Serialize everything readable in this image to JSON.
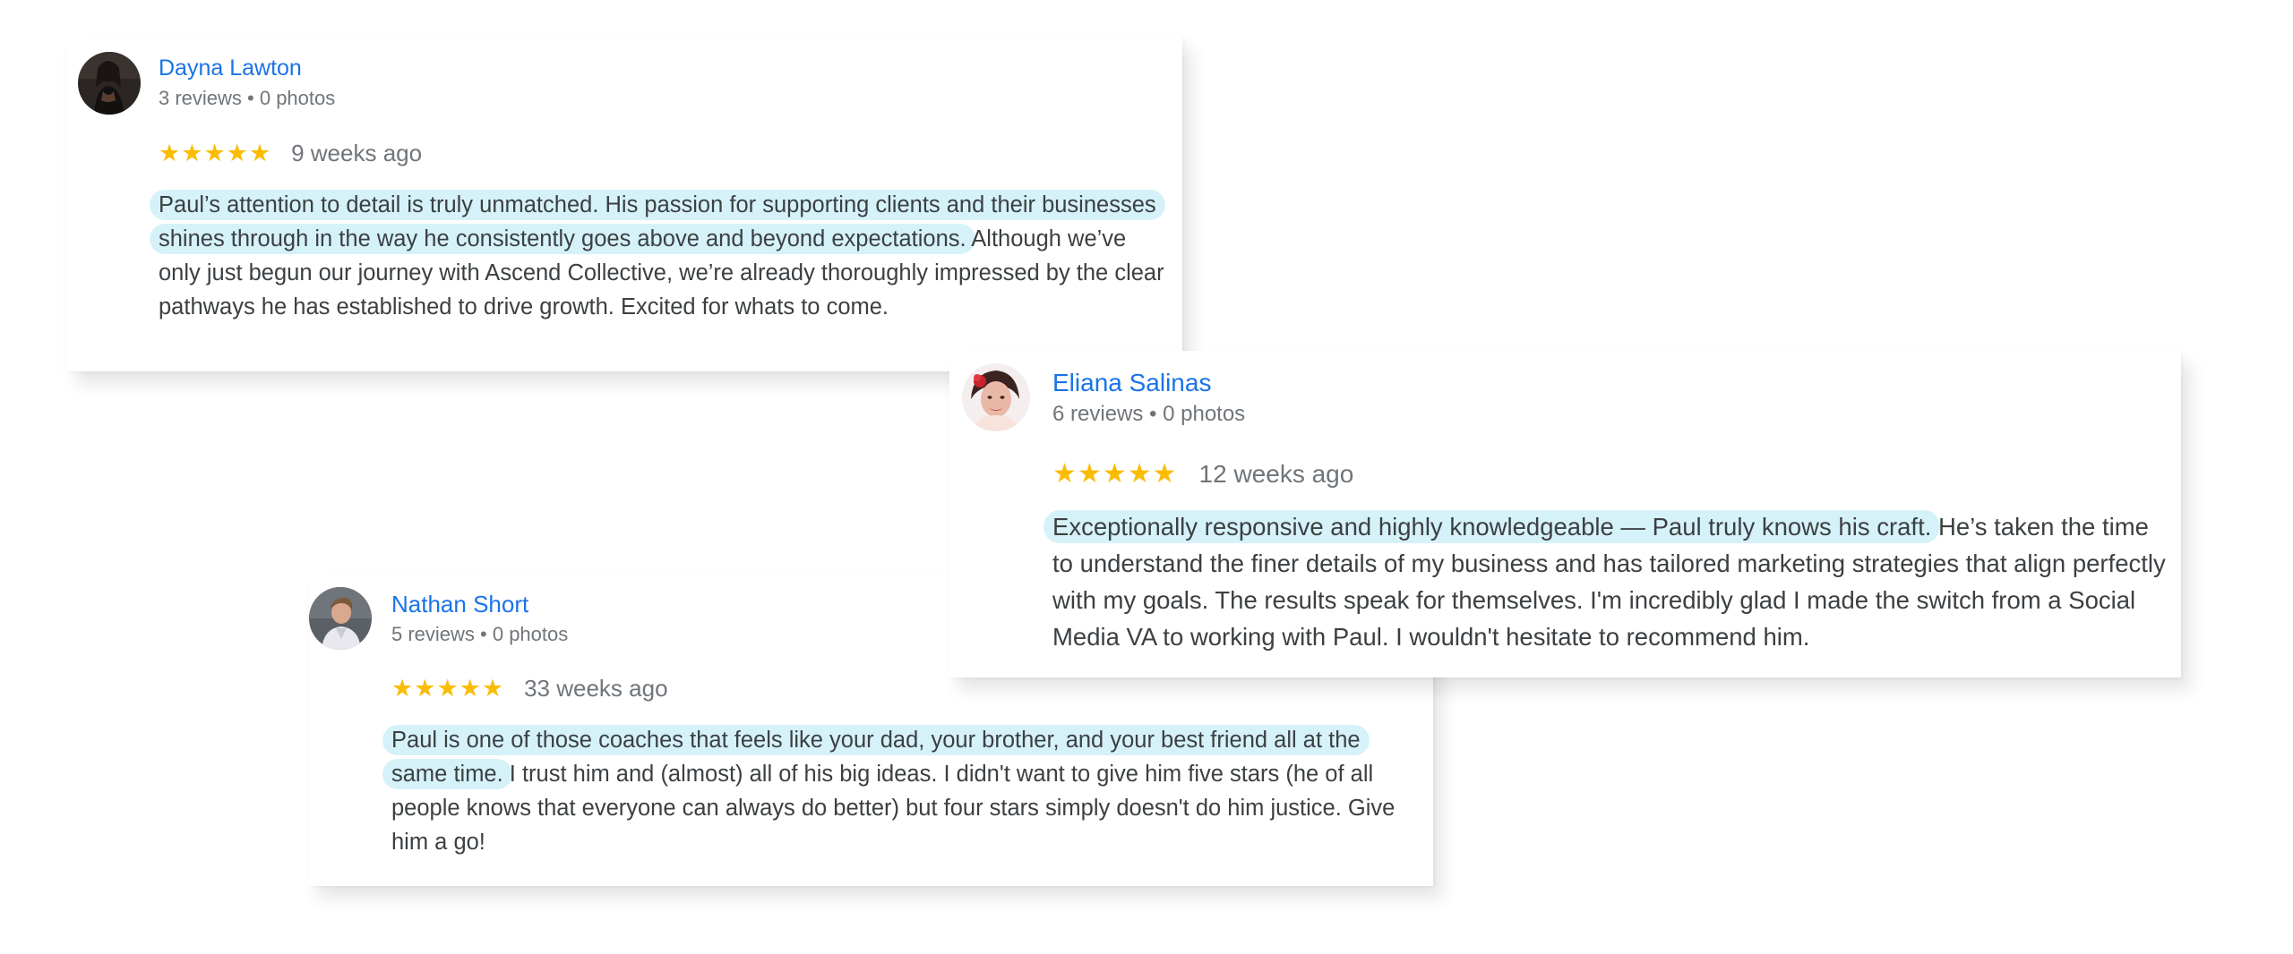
{
  "reviews": [
    {
      "reviewer_name": "Dayna Lawton",
      "reviewer_meta": "3 reviews • 0 photos",
      "rating": 5,
      "star_glyph": "★",
      "time_ago": "9 weeks ago",
      "text_highlight": "Paul’s attention to detail is truly unmatched. His passion for supporting clients and their businesses shines through in the way he consistently goes above and beyond expectations.",
      "text_rest": " Although we’ve only just begun our journey with Ascend Collective, we’re already thoroughly impressed by the clear pathways he has established to drive growth. Excited for whats to come."
    },
    {
      "reviewer_name": "Eliana Salinas",
      "reviewer_meta": "6 reviews • 0 photos",
      "rating": 5,
      "star_glyph": "★",
      "time_ago": "12 weeks ago",
      "text_highlight": "Exceptionally responsive and highly knowledgeable — Paul truly knows his craft.",
      "text_rest": " He’s taken the time to understand the finer details of my business and has tailored marketing strategies that align perfectly with my goals. The results speak for themselves. I'm incredibly glad I made the switch from a Social Media VA to working with Paul. I wouldn't hesitate to recommend him."
    },
    {
      "reviewer_name": "Nathan Short",
      "reviewer_meta": "5 reviews • 0 photos",
      "rating": 5,
      "star_glyph": "★",
      "time_ago": "33 weeks ago",
      "text_highlight": "Paul is one of those coaches that feels like your dad, your brother, and your best friend all at the same time.",
      "text_rest": " I trust him and (almost) all of his big ideas. I didn't want to give him five stars (he of all people knows that everyone can always do better) but four stars simply doesn't do him justice. Give him a go!"
    }
  ],
  "colors": {
    "name_link": "#1a73e8",
    "meta_gray": "#70757a",
    "star": "#fbbc04",
    "highlight": "#d6f2f9",
    "body_text": "#3c4043"
  }
}
